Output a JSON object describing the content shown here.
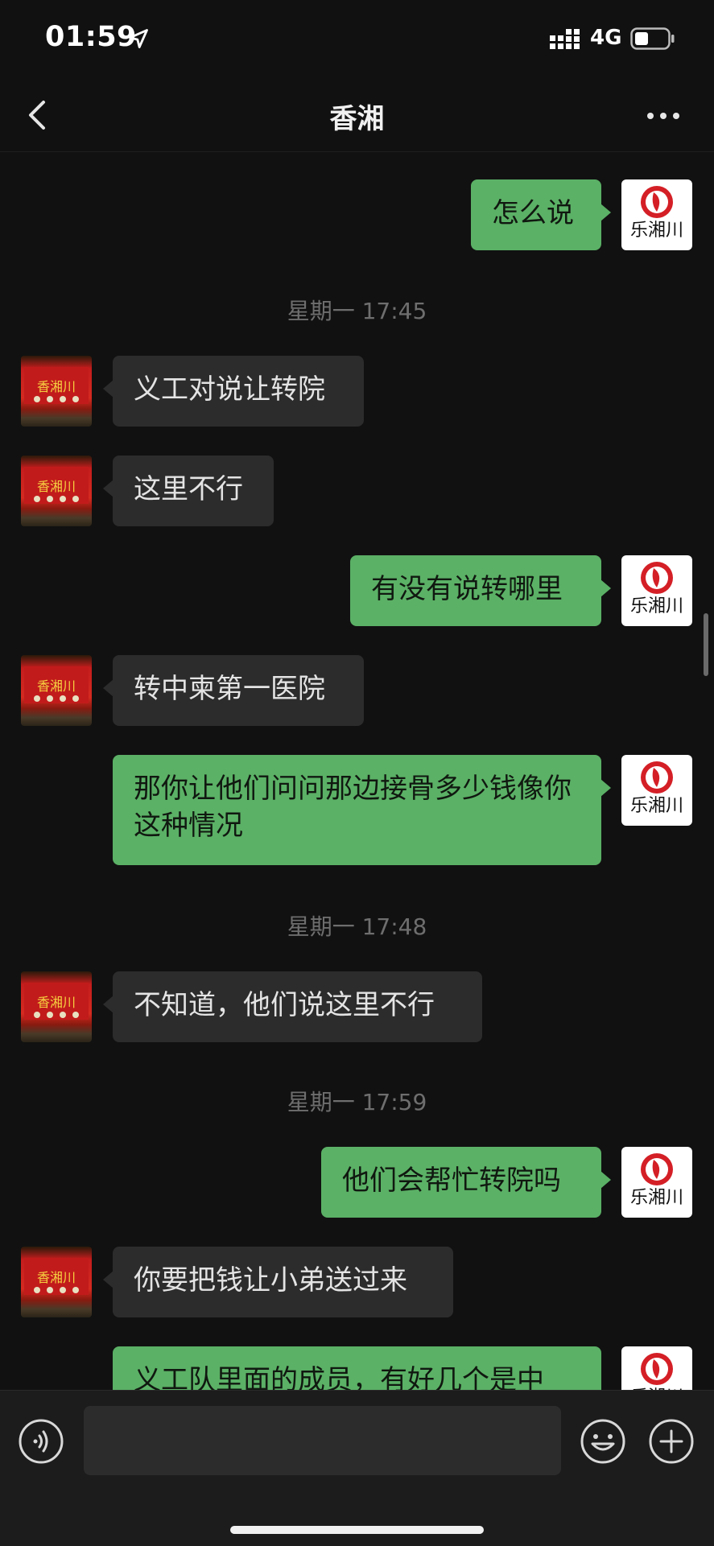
{
  "status_bar": {
    "time": "01:59",
    "network": "4G",
    "icons": [
      "location-arrow-icon",
      "signal-bars-icon",
      "battery-icon"
    ]
  },
  "nav": {
    "title": "香湘",
    "back_icon": "chevron-left-icon",
    "more_icon": "ellipsis-icon"
  },
  "messages": [
    {
      "from": "me",
      "text": "怎么说"
    },
    {
      "type": "time",
      "text": "星期一 17:45"
    },
    {
      "from": "them",
      "text": "义工对说让转院"
    },
    {
      "from": "them",
      "text": "这里不行"
    },
    {
      "from": "me",
      "text": "有没有说转哪里"
    },
    {
      "from": "them",
      "text": "转中柬第一医院"
    },
    {
      "from": "me",
      "text": "那你让他们问问那边接骨多少钱像你这种情况"
    },
    {
      "type": "time",
      "text": "星期一 17:48"
    },
    {
      "from": "them",
      "text": "不知道，他们说这里不行"
    },
    {
      "type": "time",
      "text": "星期一 17:59"
    },
    {
      "from": "me",
      "text": "他们会帮忙转院吗"
    },
    {
      "from": "them",
      "text": "你要把钱让小弟送过来"
    },
    {
      "from": "me",
      "text": "义工队里面的成员，有好几个是中"
    }
  ],
  "avatars": {
    "me_label": "乐湘川",
    "them_sign": "香湘川"
  },
  "input_bar": {
    "placeholder": "",
    "voice_icon": "voice-icon",
    "emoji_icon": "emoji-icon",
    "plus_icon": "plus-icon"
  },
  "colors": {
    "me_bubble": "#5bb166",
    "them_bubble": "#2c2c2c",
    "background": "#111111"
  }
}
